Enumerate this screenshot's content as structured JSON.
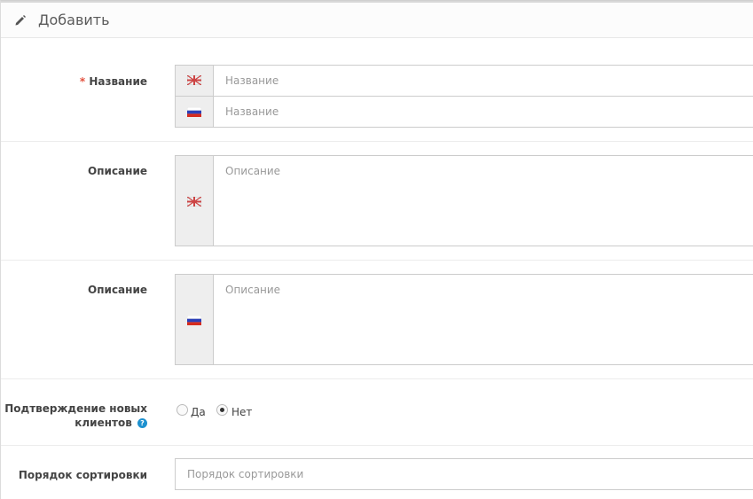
{
  "header": {
    "title": "Добавить",
    "icon": "pencil-icon"
  },
  "form": {
    "name": {
      "label": "Название",
      "required_mark": "*",
      "en_placeholder": "Название",
      "ru_placeholder": "Название"
    },
    "desc_en": {
      "label": "Описание",
      "placeholder": "Описание"
    },
    "desc_ru": {
      "label": "Описание",
      "placeholder": "Описание"
    },
    "approval": {
      "label_line1": "Подтверждение новых",
      "label_line2": "клиентов",
      "help_glyph": "?",
      "options": [
        "Да",
        "Нет"
      ],
      "selected": "Нет"
    },
    "sort": {
      "label": "Порядок сортировки",
      "placeholder": "Порядок сортировки"
    }
  },
  "colors": {
    "required": "#e3503e",
    "help": "#1e91cf"
  }
}
